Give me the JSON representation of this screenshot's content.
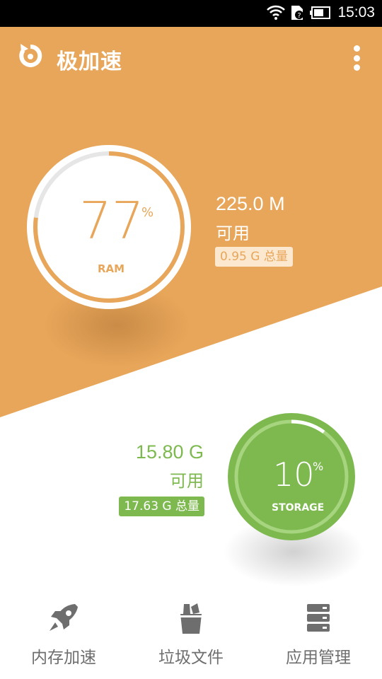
{
  "status_bar": {
    "time": "15:03",
    "icons": [
      "wifi-icon",
      "sim-unknown-icon",
      "battery-icon"
    ]
  },
  "app": {
    "title": "极加速",
    "logo": "app-logo-icon",
    "menu": "more-vert-icon"
  },
  "ram": {
    "percent": "77",
    "percent_sign": "%",
    "label": "RAM",
    "available": "225.0 M",
    "available_label": "可用",
    "total": "0.95 G 总量",
    "fill_fraction": 0.77
  },
  "storage": {
    "percent": "10",
    "percent_sign": "%",
    "label": "STORAGE",
    "available": "15.80 G",
    "available_label": "可用",
    "total": "17.63 G 总量",
    "fill_fraction": 0.1
  },
  "nav": [
    {
      "label": "内存加速",
      "icon": "rocket-icon"
    },
    {
      "label": "垃圾文件",
      "icon": "trash-bin-icon"
    },
    {
      "label": "应用管理",
      "icon": "app-manage-icon"
    }
  ],
  "colors": {
    "orange": "#E8A65A",
    "green": "#7DB94F",
    "text_gray": "#6e6e6e"
  }
}
